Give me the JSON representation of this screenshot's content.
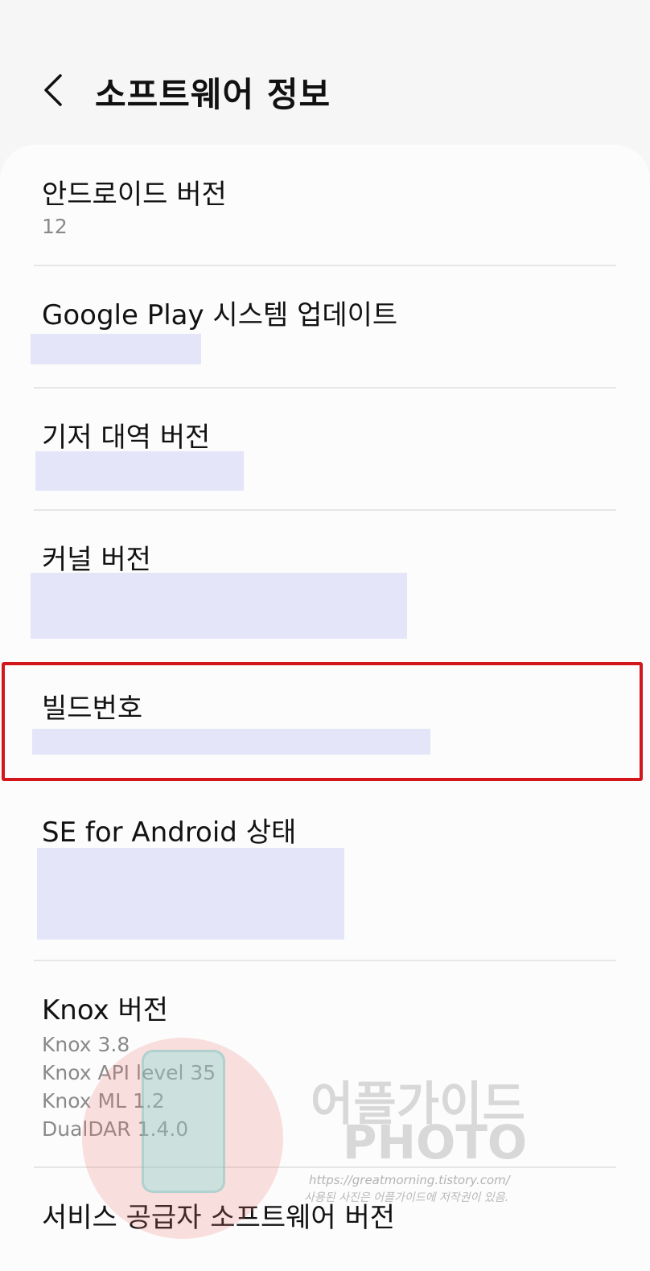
{
  "header": {
    "title": "소프트웨어 정보",
    "back_icon": "chevron-left-icon"
  },
  "items": [
    {
      "title": "안드로이드 버전",
      "value": "12"
    },
    {
      "title": "Google Play 시스템 업데이트"
    },
    {
      "title": "기저 대역 버전"
    },
    {
      "title": "커널 버전"
    },
    {
      "title": "빌드번호"
    },
    {
      "title": "SE for Android 상태"
    },
    {
      "title": "Knox 버전",
      "lines": [
        "Knox 3.8",
        "Knox API level 35",
        "Knox ML 1.2",
        "DualDAR 1.4.0"
      ]
    },
    {
      "title": "서비스 공급자 소프트웨어 버전"
    }
  ],
  "watermark": {
    "line1": "어플가이드",
    "line2": "PHOTO",
    "url": "https://greatmorning.tistory.com/",
    "copyright": "사용된 사진은 어플가이드에 저작권이 있음."
  },
  "colors": {
    "highlight": "#d3151c",
    "redaction": "#e4e5f8",
    "background": "#f6f6f6"
  }
}
